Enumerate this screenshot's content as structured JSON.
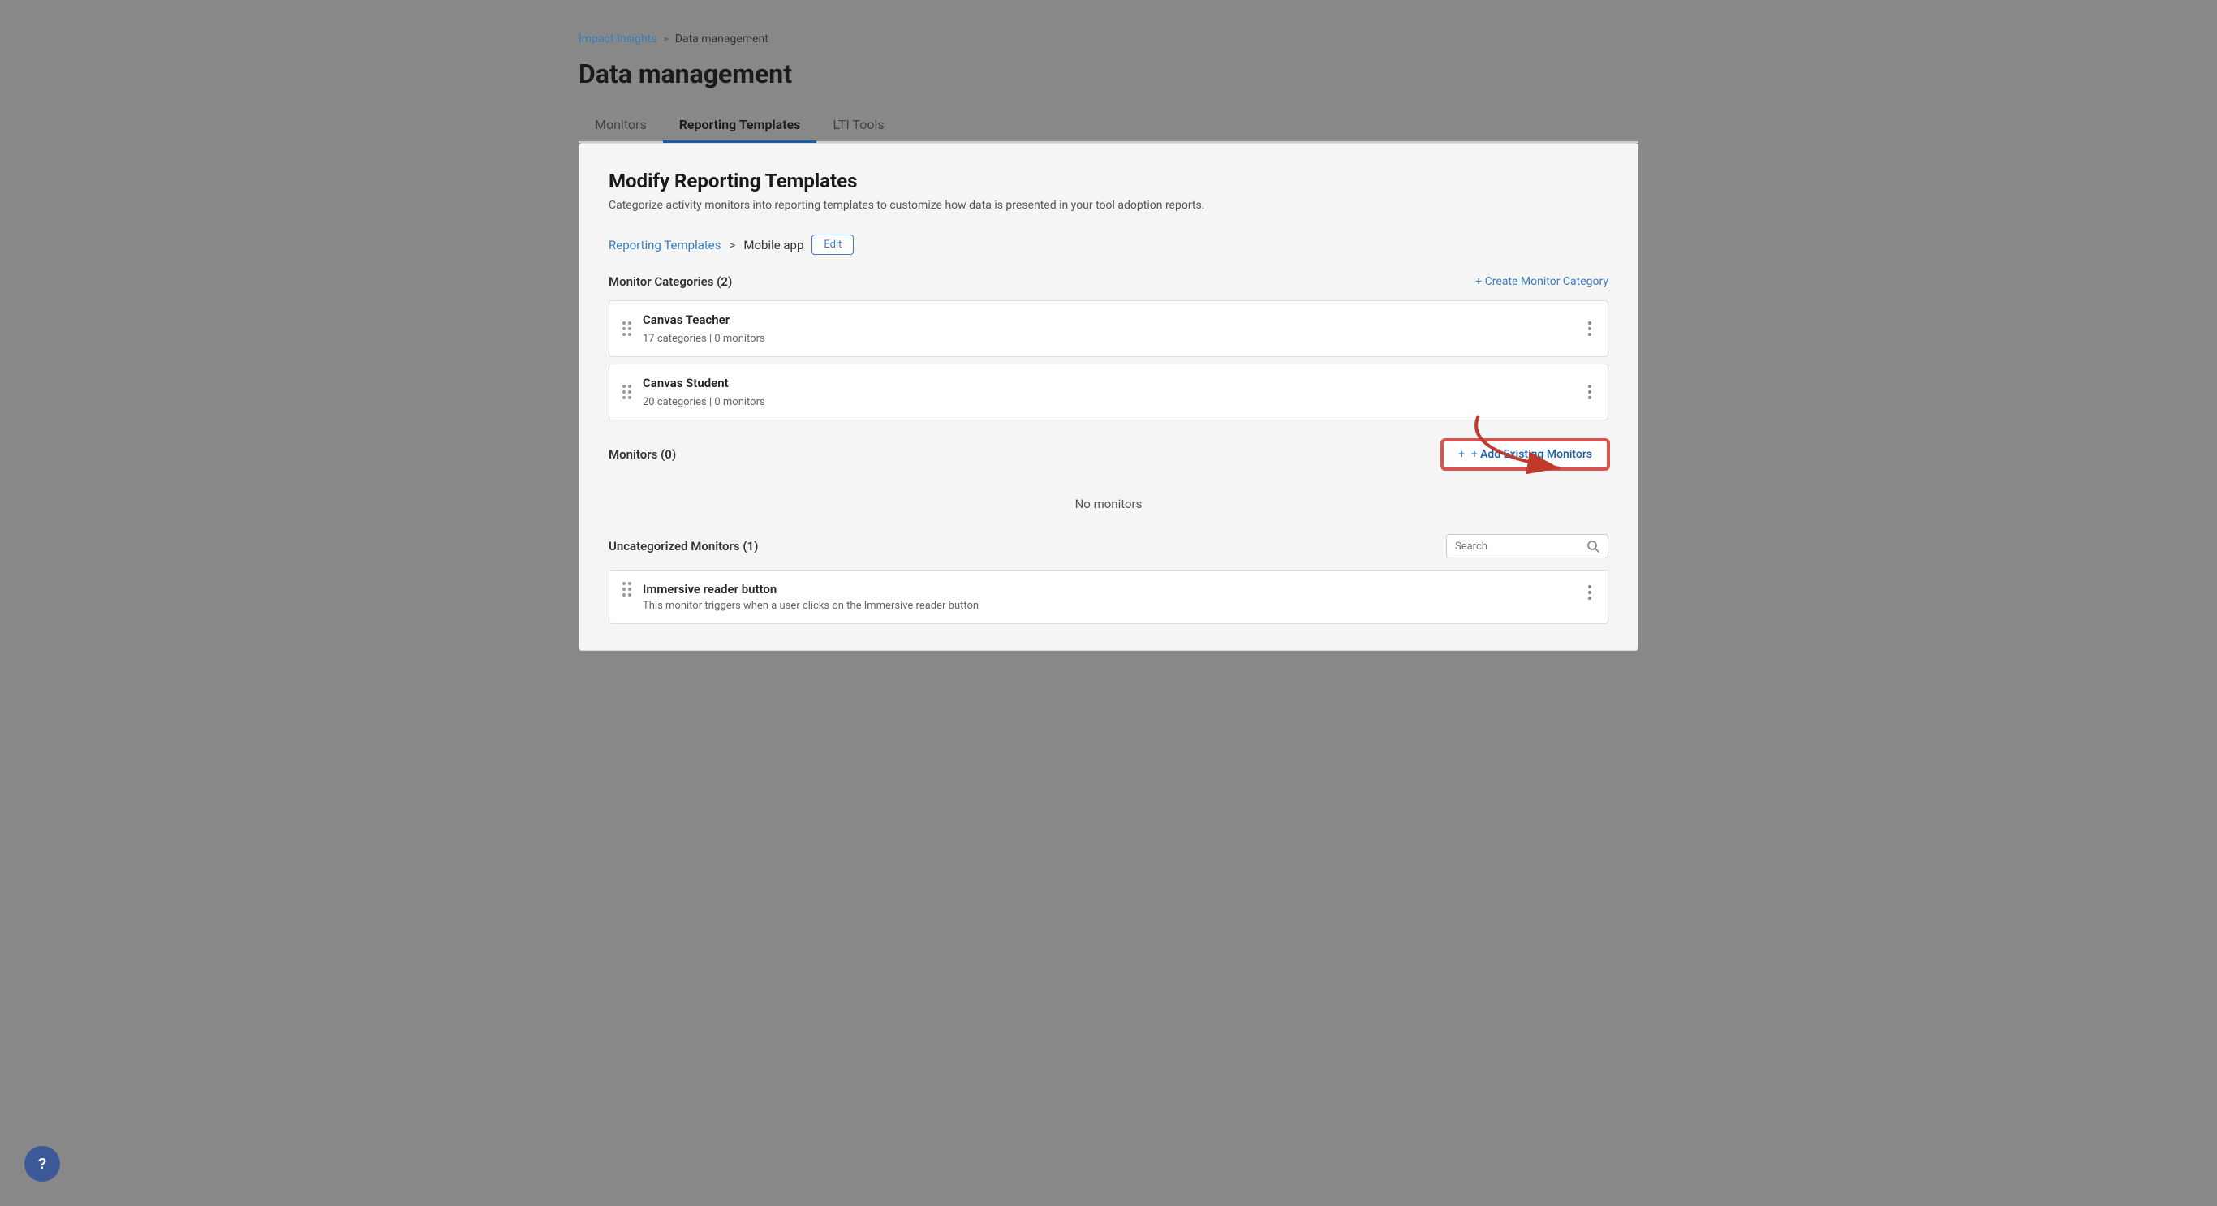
{
  "breadcrumb": {
    "link_label": "Impact Insights",
    "separator": ">",
    "current": "Data management"
  },
  "page": {
    "title": "Data management"
  },
  "tabs": [
    {
      "label": "Monitors",
      "active": false
    },
    {
      "label": "Reporting Templates",
      "active": true
    },
    {
      "label": "LTI Tools",
      "active": false
    }
  ],
  "content": {
    "section_title": "Modify Reporting Templates",
    "section_desc": "Categorize activity monitors into reporting templates to customize how data is presented in your tool adoption reports.",
    "template_breadcrumb": {
      "link_label": "Reporting Templates",
      "separator": ">",
      "current": "Mobile app",
      "edit_label": "Edit"
    },
    "monitor_categories": {
      "label": "Monitor Categories (2)",
      "create_link": "+ Create Monitor Category",
      "items": [
        {
          "name": "Canvas Teacher",
          "meta": "17 categories  |  0 monitors"
        },
        {
          "name": "Canvas Student",
          "meta": "20 categories  |  0 monitors"
        }
      ]
    },
    "monitors": {
      "label": "Monitors (0)",
      "add_btn": "+ Add Existing Monitors",
      "empty_text": "No monitors"
    },
    "uncategorized": {
      "label": "Uncategorized Monitors (1)",
      "search_placeholder": "Search",
      "items": [
        {
          "name": "Immersive reader button",
          "desc": "This monitor triggers when a user clicks on the Immersive reader button"
        }
      ]
    }
  },
  "help": {
    "icon": "?"
  }
}
